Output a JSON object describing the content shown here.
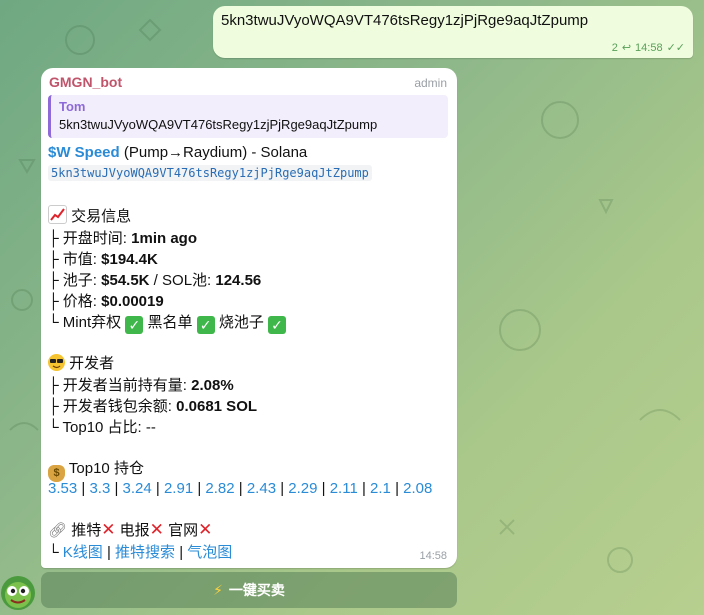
{
  "outgoing": {
    "text": "5kn3twuJVyoWQA9VT476tsRegy1zjPjRge9aqJtZpump",
    "forward_count": "2",
    "time": "14:58"
  },
  "message": {
    "sender": "GMGN_bot",
    "role": "admin",
    "reply": {
      "name": "Tom",
      "text": "5kn3twuJVyoWQA9VT476tsRegy1zjPjRge9aqJtZpump"
    },
    "token_symbol": "$W Speed",
    "route": " (Pump→Raydium) - Solana",
    "contract": "5kn3twuJVyoWQA9VT476tsRegy1zjPjRge9aqJtZpump",
    "trade_header": "交易信息",
    "open_time_label": "├ 开盘时间: ",
    "open_time_value": "1min ago",
    "market_cap_label": "├ 市值: ",
    "market_cap_value": "$194.4K",
    "pool_label": "├ 池子: ",
    "pool_value": "$54.5K",
    "pool_sep": " / SOL池: ",
    "sol_pool_value": "124.56",
    "price_label": "├ 价格: ",
    "price_value": "$0.00019",
    "mint_label": "└ Mint弃权",
    "blacklist_label": " 黑名单",
    "burn_label": " 烧池子",
    "dev_header": "开发者",
    "dev_hold_label": "├ 开发者当前持有量: ",
    "dev_hold_value": "2.08%",
    "dev_wallet_label": "├ 开发者钱包余额: ",
    "dev_wallet_value": "0.0681 SOL",
    "top10_share": "└ Top10 占比: --",
    "top10_header": "Top10 持仓",
    "top10_values": [
      "3.53",
      "3.3",
      "3.24",
      "2.91",
      "2.82",
      "2.43",
      "2.29",
      "2.11",
      "2.1",
      "2.08"
    ],
    "social_twitter": "推特",
    "social_telegram": "电报",
    "social_site": "官网",
    "links_prefix": "└ ",
    "link_kline": "K线图",
    "link_search": "推特搜索",
    "link_bubble": "气泡图",
    "link_sep": " | ",
    "time": "14:58"
  },
  "keyboard": {
    "buy_button": "一键买卖"
  }
}
